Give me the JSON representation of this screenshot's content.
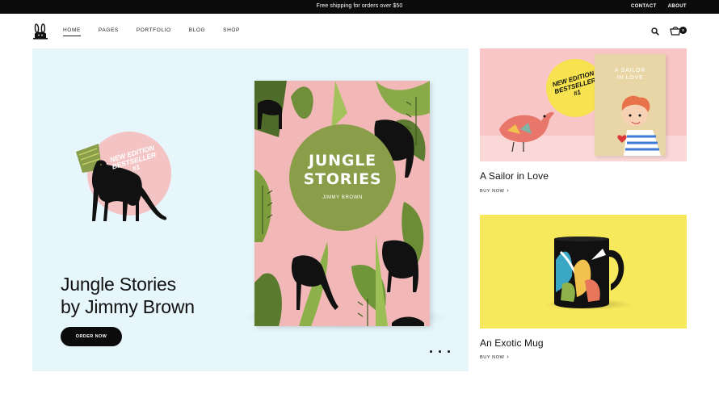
{
  "topbar": {
    "promo": "Free shipping for orders over $50",
    "links": [
      "CONTACT",
      "ABOUT"
    ]
  },
  "header": {
    "logo_icon": "bunny-logo-icon",
    "nav": [
      "HOME",
      "PAGES",
      "PORTFOLIO",
      "BLOG",
      "SHOP"
    ],
    "active_nav": "HOME",
    "search_icon": "search-icon",
    "cart_icon": "cart-icon",
    "cart_count": "0"
  },
  "hero": {
    "title_line1": "Jungle Stories",
    "title_line2": "by Jimmy Brown",
    "cta": "ORDER NOW",
    "badge": {
      "line1": "NEW EDITION",
      "line2": "BESTSELLER",
      "line3": "#1"
    },
    "book": {
      "title_line1": "JUNGLE",
      "title_line2": "STORIES",
      "author": "JIMMY BROWN"
    },
    "slider_dots": 3,
    "colors": {
      "background": "#e6f6fb",
      "book_cover": "#f2b8b8",
      "book_circle": "#8a9e4a",
      "badge_circle": "#f4c4c4"
    }
  },
  "cards": [
    {
      "title": "A Sailor in Love",
      "link": "BUY NOW",
      "badge": {
        "line1": "NEW EDITION",
        "line2": "BESTSELLER",
        "line3": "#1"
      },
      "book_title_line1": "A SAILOR",
      "book_title_line2": "IN LOVE",
      "background": "#f8c6c6"
    },
    {
      "title": "An Exotic Mug",
      "link": "BUY NOW",
      "background": "#f7e95c"
    }
  ]
}
